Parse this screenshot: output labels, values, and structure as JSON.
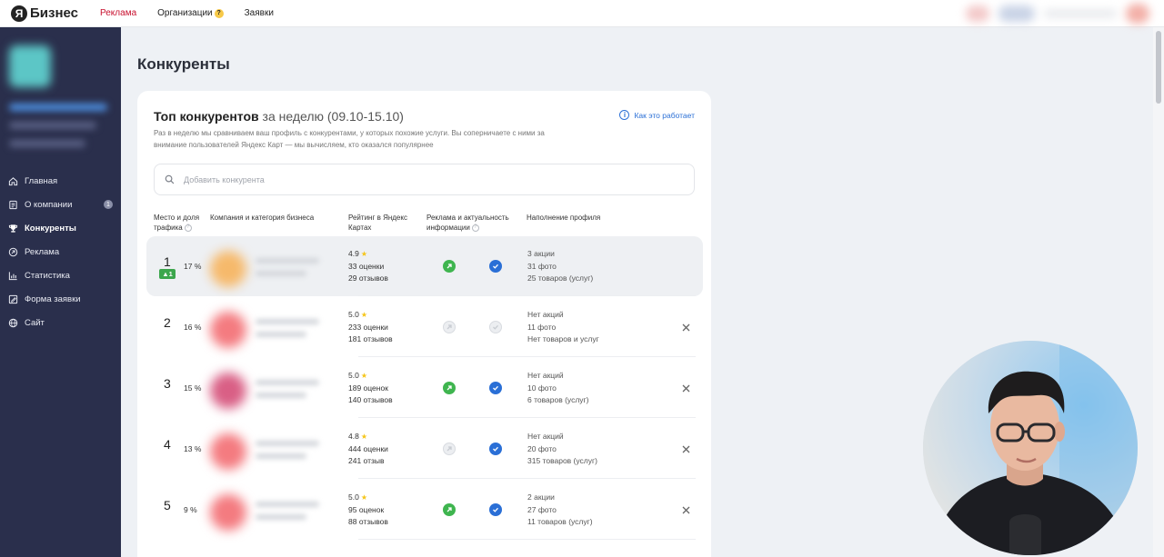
{
  "topbar": {
    "logo_letter": "Я",
    "brand": "Бизнес",
    "nav": [
      {
        "label": "Реклама",
        "active": true
      },
      {
        "label": "Организации",
        "badge": "?",
        "active": false
      },
      {
        "label": "Заявки",
        "active": false
      }
    ]
  },
  "sidebar": {
    "items": [
      {
        "label": "Главная",
        "icon": "home-icon",
        "active": false
      },
      {
        "label": "О компании",
        "icon": "document-icon",
        "badge": "1",
        "active": false
      },
      {
        "label": "Конкуренты",
        "icon": "trophy-icon",
        "active": true
      },
      {
        "label": "Реклама",
        "icon": "ad-icon",
        "active": false
      },
      {
        "label": "Статистика",
        "icon": "chart-icon",
        "active": false
      },
      {
        "label": "Форма заявки",
        "icon": "form-icon",
        "active": false
      },
      {
        "label": "Сайт",
        "icon": "globe-icon",
        "active": false
      }
    ]
  },
  "main": {
    "page_title": "Конкуренты",
    "card": {
      "title": "Топ конкурентов",
      "title_week": "за неделю (09.10-15.10)",
      "how_link": "Как это работает",
      "description": "Раз в неделю мы сравниваем ваш профиль с конкурентами, у которых похожие услуги. Вы соперничаете с ними за внимание пользователей Яндекс Карт — мы вычисляем, кто оказался популярнее",
      "search_placeholder": "Добавить конкурента",
      "columns": {
        "place": "Место и доля трафика",
        "company": "Компания и категория бизнеса",
        "rating": "Рейтинг в Яндекс Картах",
        "ads": "Реклама и актуальность информации",
        "fill": "Наполнение профиля"
      },
      "rows": [
        {
          "rank": "1",
          "change": "1",
          "share": "17 %",
          "rating": "4.9",
          "scores": "33 оценки",
          "reviews": "29 отзывов",
          "ads": true,
          "actual": true,
          "promos": "3 акции",
          "photos": "31 фото",
          "goods": "25 товаров (услуг)",
          "avatar_color": "#f6b96b",
          "highlighted": true
        },
        {
          "rank": "2",
          "share": "16 %",
          "rating": "5.0",
          "scores": "233 оценки",
          "reviews": "181 отзывов",
          "ads": false,
          "actual": false,
          "promos": "Нет акций",
          "photos": "11 фото",
          "goods": "Нет товаров и услуг",
          "avatar_color": "#f47b80",
          "highlighted": false
        },
        {
          "rank": "3",
          "share": "15 %",
          "rating": "5.0",
          "scores": "189 оценок",
          "reviews": "140 отзывов",
          "ads": true,
          "actual": true,
          "promos": "Нет акций",
          "photos": "10 фото",
          "goods": "6 товаров (услуг)",
          "avatar_color": "#d95f85",
          "highlighted": false
        },
        {
          "rank": "4",
          "share": "13 %",
          "rating": "4.8",
          "scores": "444 оценки",
          "reviews": "241 отзыв",
          "ads": false,
          "actual": true,
          "promos": "Нет акций",
          "photos": "20 фото",
          "goods": "315 товаров (услуг)",
          "avatar_color": "#f47b80",
          "highlighted": false
        },
        {
          "rank": "5",
          "share": "9 %",
          "rating": "5.0",
          "scores": "95 оценок",
          "reviews": "88 отзывов",
          "ads": true,
          "actual": true,
          "promos": "2 акции",
          "photos": "27 фото",
          "goods": "11 товаров (услуг)",
          "avatar_color": "#f47b80",
          "highlighted": false
        }
      ]
    }
  },
  "colors": {
    "accent_red": "#c8102e",
    "sidebar_bg": "#2a2f4c",
    "link_blue": "#2a6fd6",
    "ads_green": "#3fb54f",
    "star": "#f5c518"
  }
}
